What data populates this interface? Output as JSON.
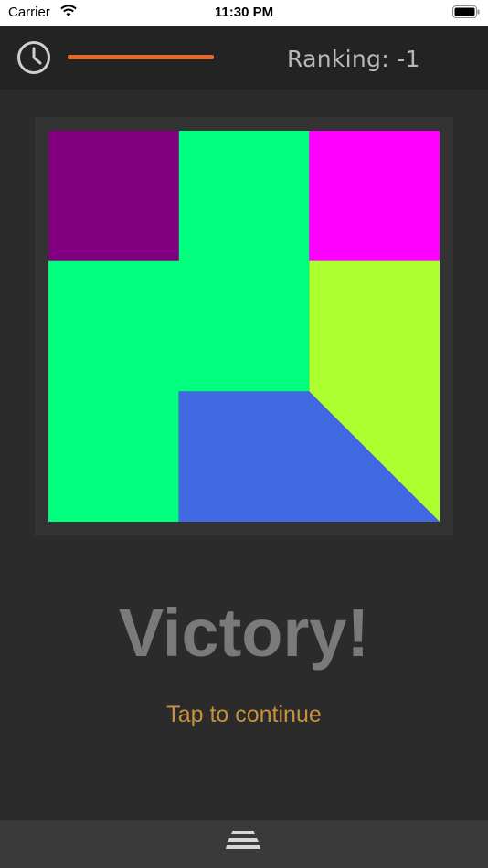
{
  "status_bar": {
    "carrier": "Carrier",
    "time": "11:30 PM"
  },
  "header": {
    "timer_icon": "clock-icon",
    "timer_progress": 1.0,
    "timer_color": "#e8672a",
    "ranking_text": "Ranking: -1"
  },
  "board": {
    "grid_size": 3,
    "pieces": [
      {
        "name": "purple-piece",
        "color": "#800080",
        "cells": "top-left square"
      },
      {
        "name": "magenta-piece",
        "color": "#ff00ff",
        "cells": "top-right square"
      },
      {
        "name": "green-piece",
        "color": "#00ff7f",
        "cells": "top-middle, middle-left, middle-middle, bottom-left"
      },
      {
        "name": "lime-piece",
        "color": "#adff2f",
        "cells": "middle-right square plus bottom-right upper triangle"
      },
      {
        "name": "blue-piece",
        "color": "#4169e1",
        "cells": "bottom-middle square plus bottom-right lower triangle"
      }
    ]
  },
  "result": {
    "title": "Victory!",
    "action": "Tap to continue"
  },
  "bottom_bar": {
    "menu_icon": "menu-icon"
  }
}
